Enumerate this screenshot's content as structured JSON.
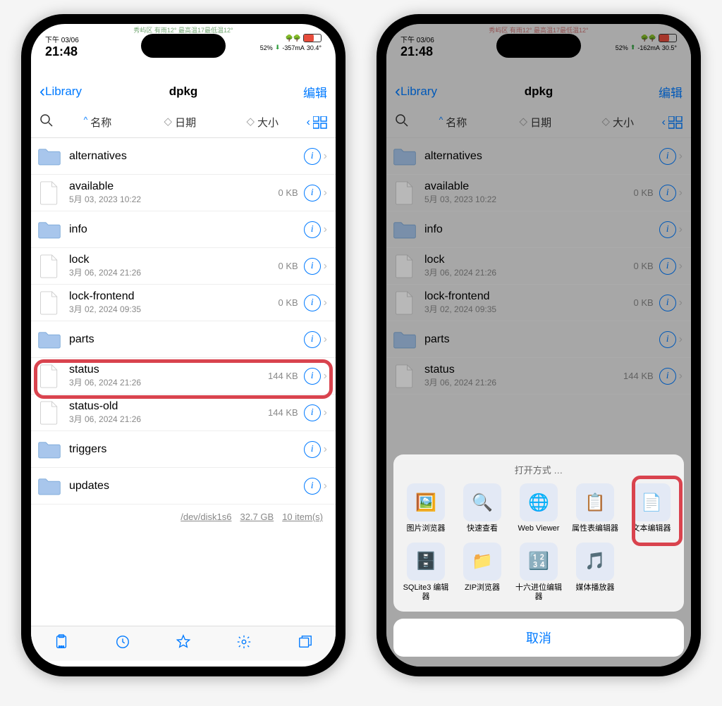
{
  "status": {
    "weather_line": "秀屿区 有雨12° 最高温17最低温12°",
    "date": "下午 03/06",
    "time": "21:48",
    "battery": "52%",
    "current_left": "-357mA",
    "current_right": "-162mA",
    "temp_left": "30.4°",
    "temp_right": "30.5°"
  },
  "nav": {
    "back": "Library",
    "title": "dpkg",
    "edit": "编辑"
  },
  "sort": {
    "name": "名称",
    "date": "日期",
    "size": "大小"
  },
  "files": [
    {
      "name": "alternatives",
      "type": "folder",
      "date": "",
      "size": ""
    },
    {
      "name": "available",
      "type": "file",
      "date": "5月 03, 2023 10:22",
      "size": "0 KB"
    },
    {
      "name": "info",
      "type": "folder",
      "date": "",
      "size": ""
    },
    {
      "name": "lock",
      "type": "file",
      "date": "3月 06, 2024 21:26",
      "size": "0 KB"
    },
    {
      "name": "lock-frontend",
      "type": "file",
      "date": "3月 02, 2024 09:35",
      "size": "0 KB"
    },
    {
      "name": "parts",
      "type": "folder",
      "date": "",
      "size": ""
    },
    {
      "name": "status",
      "type": "file",
      "date": "3月 06, 2024 21:26",
      "size": "144 KB"
    },
    {
      "name": "status-old",
      "type": "file",
      "date": "3月 06, 2024 21:26",
      "size": "144 KB"
    },
    {
      "name": "triggers",
      "type": "folder",
      "date": "",
      "size": ""
    },
    {
      "name": "updates",
      "type": "folder",
      "date": "",
      "size": ""
    }
  ],
  "summary": {
    "disk": "/dev/disk1s6",
    "capacity": "32.7 GB",
    "count": "10 item(s)"
  },
  "sheet": {
    "title": "打开方式 …",
    "apps_row1": [
      {
        "label": "图片浏览器"
      },
      {
        "label": "快速查看"
      },
      {
        "label": "Web Viewer"
      },
      {
        "label": "属性表编辑器"
      },
      {
        "label": "文本编辑器"
      }
    ],
    "apps_row2": [
      {
        "label": "SQLite3 编辑器"
      },
      {
        "label": "ZIP浏览器"
      },
      {
        "label": "十六进位编辑器"
      },
      {
        "label": "媒体播放器"
      }
    ],
    "cancel": "取消"
  }
}
